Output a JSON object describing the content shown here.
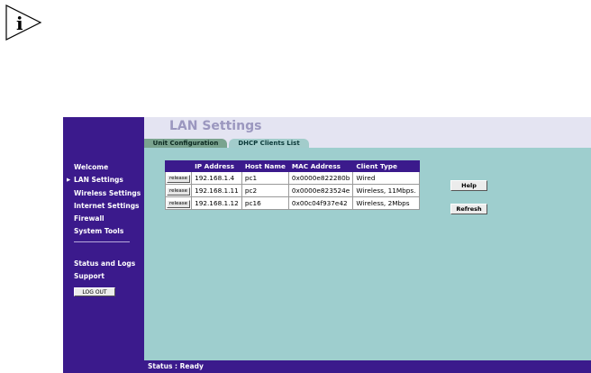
{
  "note": {
    "glyph": "i"
  },
  "sidebar": {
    "items": [
      {
        "label": "Welcome",
        "active": false
      },
      {
        "label": "LAN Settings",
        "active": true
      },
      {
        "label": "Wireless Settings",
        "active": false
      },
      {
        "label": "Internet Settings",
        "active": false
      },
      {
        "label": "Firewall",
        "active": false
      },
      {
        "label": "System Tools",
        "active": false
      }
    ],
    "secondary": [
      {
        "label": "Status and Logs"
      },
      {
        "label": "Support"
      }
    ],
    "logout_label": "LOG OUT"
  },
  "header": {
    "title": "LAN Settings",
    "tabs": [
      {
        "label": "Unit Configuration",
        "active": false
      },
      {
        "label": "DHCP Clients List",
        "active": true
      }
    ]
  },
  "table": {
    "columns": [
      "",
      "IP Address",
      "Host Name",
      "MAC Address",
      "Client Type"
    ],
    "release_label": "release",
    "rows": [
      {
        "ip": "192.168.1.4",
        "host": "pc1",
        "mac": "0x0000e822280b",
        "type": "Wired"
      },
      {
        "ip": "192.168.1.11",
        "host": "pc2",
        "mac": "0x0000e823524e",
        "type": "Wireless, 11Mbps."
      },
      {
        "ip": "192.168.1.12",
        "host": "pc16",
        "mac": "0x00c04f937e42",
        "type": "Wireless, 2Mbps"
      }
    ]
  },
  "buttons": {
    "help": "Help",
    "refresh": "Refresh"
  },
  "status": {
    "text": "Status : Ready"
  },
  "colors": {
    "sidebar": "#3b1a8c",
    "content": "#9ecece",
    "header": "#e4e4f2",
    "title": "#9b97bf"
  }
}
